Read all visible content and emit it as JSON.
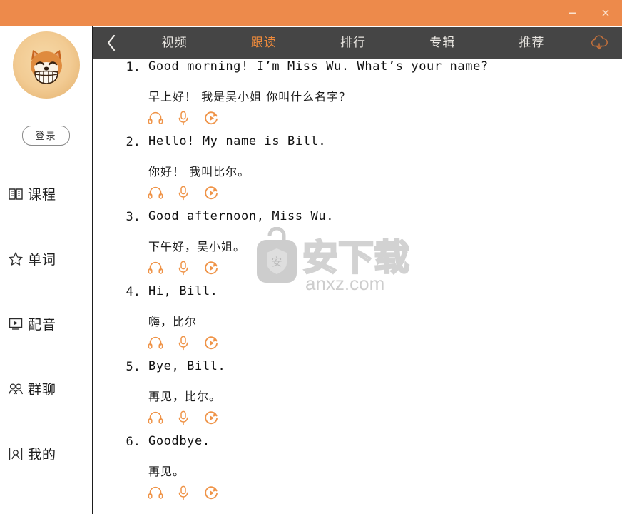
{
  "window": {
    "titlebar_color": "#ED8A4B",
    "minimize_label": "─",
    "close_label": "✕"
  },
  "sidebar": {
    "avatar_name": "shiba-avatar",
    "login_label": "登录",
    "items": [
      {
        "label": "课程",
        "icon": "book-icon"
      },
      {
        "label": "单词",
        "icon": "star-icon"
      },
      {
        "label": "配音",
        "icon": "video-icon"
      },
      {
        "label": "群聊",
        "icon": "people-icon"
      },
      {
        "label": "我的",
        "icon": "profile-icon"
      }
    ]
  },
  "tabbar": {
    "background": "#454545",
    "active_color": "#EF8B3C",
    "back_icon": "chevron-left-icon",
    "cloud_icon": "cloud-download-icon",
    "tabs": [
      {
        "label": "视频",
        "active": false
      },
      {
        "label": "跟读",
        "active": true
      },
      {
        "label": "排行",
        "active": false
      },
      {
        "label": "专辑",
        "active": false
      },
      {
        "label": "推荐",
        "active": false
      }
    ]
  },
  "content": {
    "tool_icons": [
      "headphones-icon",
      "microphone-icon",
      "play-icon"
    ],
    "sentences": [
      {
        "number": "1.",
        "en": "Good morning! I’m Miss Wu. What’s your name?",
        "zh": "早上好！ 我是吴小姐 你叫什么名字？"
      },
      {
        "number": "2.",
        "en": "Hello! My name is Bill.",
        "zh": "你好！ 我叫比尔。"
      },
      {
        "number": "3.",
        "en": "Good afternoon, Miss Wu.",
        "zh": "下午好，吴小姐。"
      },
      {
        "number": "4.",
        "en": "Hi, Bill.",
        "zh": "嗨，比尔"
      },
      {
        "number": "5.",
        "en": "Bye, Bill.",
        "zh": "再见，比尔。"
      },
      {
        "number": "6.",
        "en": "Goodbye.",
        "zh": "再见。"
      }
    ]
  },
  "watermark": {
    "cn_text": "安下载",
    "domain_text": "anxz.com",
    "badge_text": "安"
  }
}
